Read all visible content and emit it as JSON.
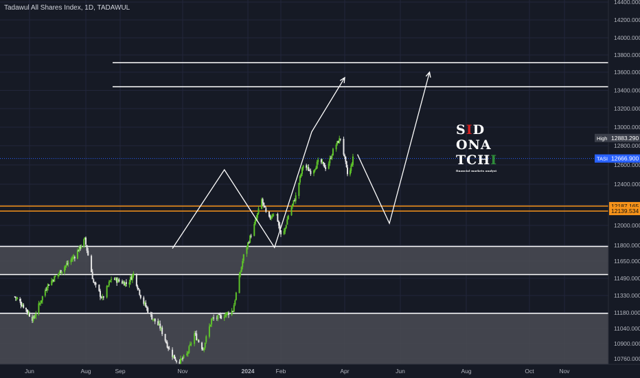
{
  "header": {
    "title": "Tadawul All Shares Index, 1D, TADAWUL"
  },
  "logo": {
    "line1": [
      "S",
      "I",
      "D"
    ],
    "line2": "ONA",
    "line3": [
      "TCH",
      "I"
    ],
    "tagline": "financial markets analyst"
  },
  "colors": {
    "background": "#161a25",
    "up": "#5ec32a",
    "down": "#e6e6e6",
    "zone": "#4a4c55",
    "line": "#ffffff",
    "orange": "#f7931a",
    "tasi_label": "#2962ff",
    "high_label": "#3b3f4a",
    "axis_text": "#b2b5be"
  },
  "chart_data": {
    "type": "candlestick",
    "symbol": "TASI",
    "y_ticks": [
      "14400.000",
      "14200.000",
      "14000.000",
      "13800.000",
      "13600.000",
      "13400.000",
      "13200.000",
      "13000.000",
      "12800.000",
      "12600.000",
      "12400.000",
      "12200.000",
      "12000.000",
      "11800.000",
      "11650.000",
      "11490.000",
      "11330.000",
      "11180.000",
      "11040.000",
      "10900.000",
      "10760.000"
    ],
    "x_ticks": [
      {
        "label": "Jun",
        "date": "2023-06-01"
      },
      {
        "label": "Aug",
        "date": "2023-08-01"
      },
      {
        "label": "Sep",
        "date": "2023-09-01"
      },
      {
        "label": "Nov",
        "date": "2023-11-01"
      },
      {
        "label": "2024",
        "date": "2024-01-01"
      },
      {
        "label": "Feb",
        "date": "2024-02-01"
      },
      {
        "label": "Apr",
        "date": "2024-04-01"
      },
      {
        "label": "Jun",
        "date": "2024-06-01"
      },
      {
        "label": "Aug",
        "date": "2024-08-01"
      },
      {
        "label": "Oct",
        "date": "2024-10-01"
      },
      {
        "label": "Nov",
        "date": "2024-11-01"
      }
    ],
    "price_path": [
      [
        "2023-05-15",
        11320
      ],
      [
        "2023-05-25",
        11240
      ],
      [
        "2023-06-05",
        11120
      ],
      [
        "2023-06-20",
        11420
      ],
      [
        "2023-07-05",
        11560
      ],
      [
        "2023-07-20",
        11700
      ],
      [
        "2023-07-31",
        11860
      ],
      [
        "2023-08-08",
        11450
      ],
      [
        "2023-08-16",
        11300
      ],
      [
        "2023-08-24",
        11490
      ],
      [
        "2023-09-01",
        11460
      ],
      [
        "2023-09-08",
        11440
      ],
      [
        "2023-09-14",
        11530
      ],
      [
        "2023-09-22",
        11300
      ],
      [
        "2023-10-01",
        11150
      ],
      [
        "2023-10-10",
        11050
      ],
      [
        "2023-10-20",
        10820
      ],
      [
        "2023-10-28",
        10720
      ],
      [
        "2023-11-05",
        10800
      ],
      [
        "2023-11-12",
        10990
      ],
      [
        "2023-11-20",
        10850
      ],
      [
        "2023-11-28",
        11120
      ],
      [
        "2023-12-08",
        11150
      ],
      [
        "2023-12-18",
        11200
      ],
      [
        "2023-12-28",
        11700
      ],
      [
        "2024-01-07",
        12000
      ],
      [
        "2024-01-14",
        12250
      ],
      [
        "2024-01-20",
        12050
      ],
      [
        "2024-01-27",
        12150
      ],
      [
        "2024-02-02",
        11850
      ],
      [
        "2024-02-08",
        12100
      ],
      [
        "2024-02-15",
        12280
      ],
      [
        "2024-02-22",
        12600
      ],
      [
        "2024-03-01",
        12520
      ],
      [
        "2024-03-08",
        12650
      ],
      [
        "2024-03-15",
        12560
      ],
      [
        "2024-03-22",
        12780
      ],
      [
        "2024-03-28",
        12880
      ],
      [
        "2024-04-05",
        12450
      ],
      [
        "2024-04-10",
        12667
      ]
    ],
    "horizontal_levels": {
      "white_lines": [
        13710,
        13440,
        11790,
        11525,
        11175
      ],
      "gray_zones": [
        [
          11525,
          11790
        ],
        [
          10650,
          11175
        ]
      ],
      "orange_lines": [
        12187.165,
        12139.534
      ]
    },
    "projection_paths": [
      [
        [
          "2023-10-22",
          11770
        ],
        [
          "2023-12-10",
          12550
        ],
        [
          "2024-01-26",
          11780
        ],
        [
          "2024-03-01",
          12950
        ],
        [
          "2024-04-01",
          13540
        ]
      ],
      [
        [
          "2024-04-15",
          12710
        ],
        [
          "2024-05-20",
          12020
        ],
        [
          "2024-06-28",
          13600
        ]
      ]
    ],
    "price_labels": [
      {
        "text": "High",
        "value_text": "12883.290",
        "value": 12883.29
      },
      {
        "text": "TASI",
        "value_text": "12666.900",
        "value": 12666.9
      },
      {
        "text": "",
        "value_text": "12187.165",
        "value": 12187.165
      },
      {
        "text": "",
        "value_text": "12139.534",
        "value": 12139.534
      }
    ]
  }
}
